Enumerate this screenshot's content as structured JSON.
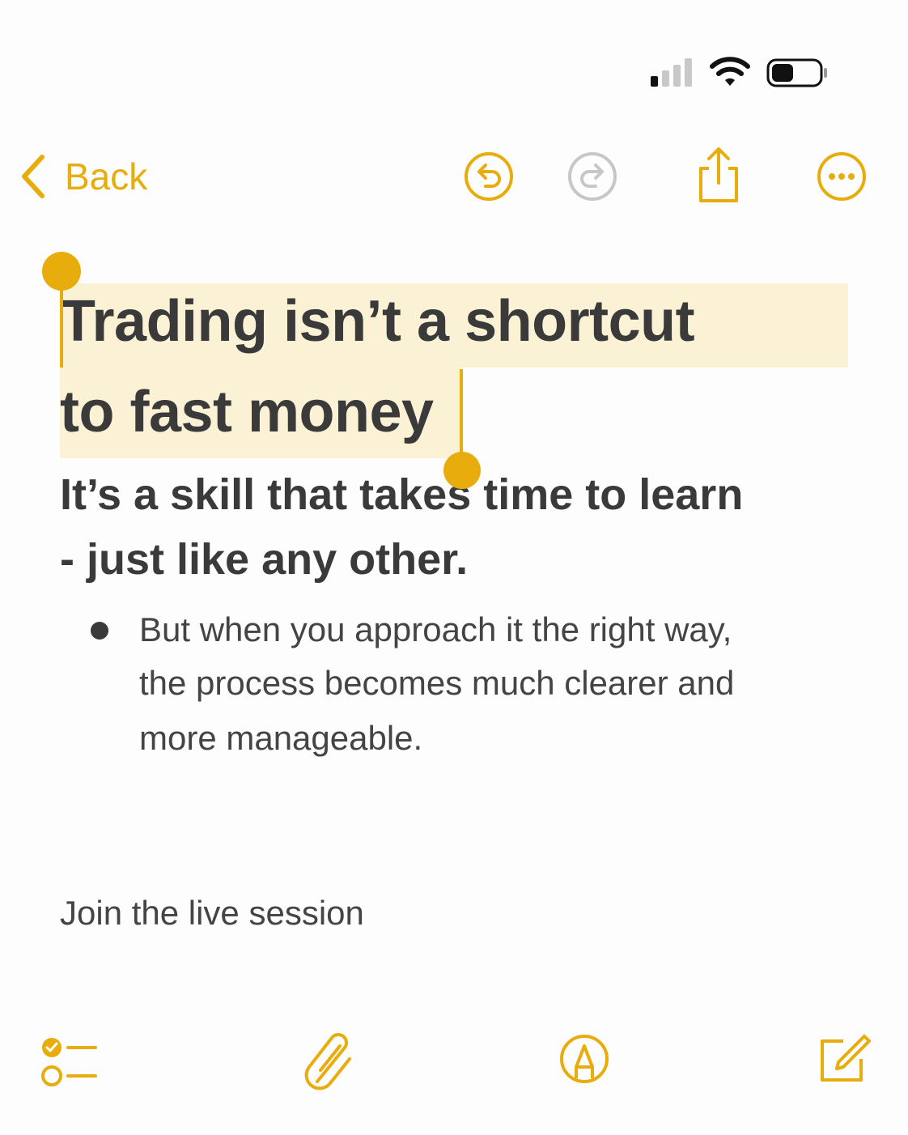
{
  "accent_color": "#e8ad0c",
  "highlight_color": "#fbf2d6",
  "status_bar": {
    "icons": [
      "cellular-signal-icon",
      "wifi-icon",
      "battery-icon"
    ]
  },
  "nav": {
    "back_label": "Back",
    "icons": [
      "undo-icon",
      "redo-icon",
      "share-icon",
      "more-icon"
    ]
  },
  "note": {
    "title_lines": [
      "Trading isn’t a shortcut",
      "to fast money"
    ],
    "subtitle_lines": [
      "It’s a skill that takes time to learn",
      "- just like any other."
    ],
    "bullet_lines": [
      "But when you approach it the right way,",
      "the process becomes much clearer and",
      "more manageable."
    ],
    "body_text": "Join the live session"
  },
  "toolbar": {
    "icons": [
      "checklist-icon",
      "attachment-icon",
      "markup-icon",
      "compose-icon"
    ]
  }
}
